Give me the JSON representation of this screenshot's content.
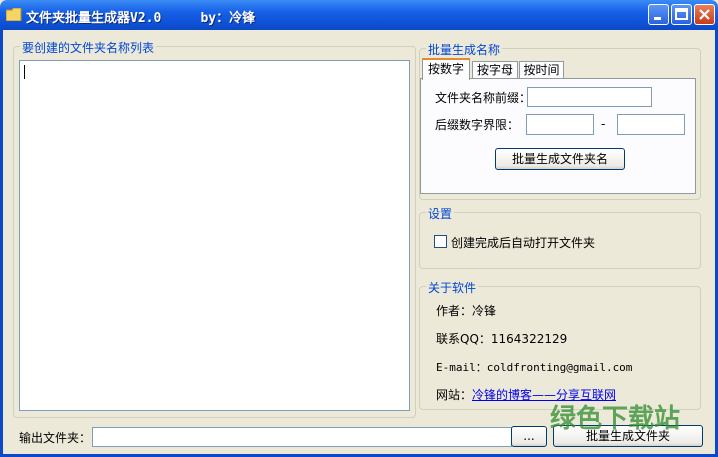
{
  "window": {
    "title": "文件夹批量生成器V2.0     by：冷锋"
  },
  "list_group": {
    "title": "要创建的文件夹名称列表"
  },
  "batch_group": {
    "title": "批量生成名称",
    "tabs": [
      "按数字",
      "按字母",
      "按时间"
    ],
    "prefix_label": "文件夹名称前缀：",
    "prefix_value": "",
    "range_label": "后缀数字界限：",
    "range_from": "",
    "range_sep": "-",
    "range_to": "",
    "generate_button": "批量生成文件夹名"
  },
  "settings_group": {
    "title": "设置",
    "auto_open_label": "创建完成后自动打开文件夹",
    "auto_open_checked": false
  },
  "about_group": {
    "title": "关于软件",
    "author": "作者：冷锋",
    "qq": "联系QQ：1164322129",
    "email": "E-mail：coldfronting@gmail.com",
    "website_label": "网站：",
    "website_link": "冷锋的博客——分享互联网"
  },
  "output": {
    "label": "输出文件夹：",
    "value": "",
    "browse_button": "...",
    "generate_button": "批量生成文件夹"
  },
  "watermark": "绿色下载站"
}
